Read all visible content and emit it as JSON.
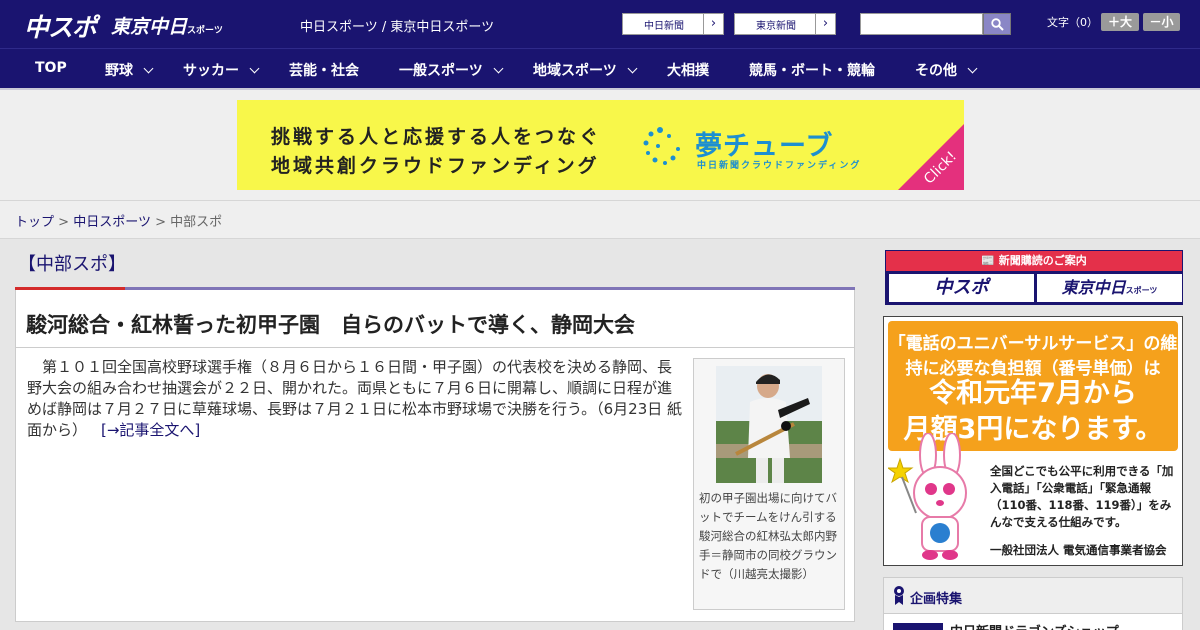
{
  "header": {
    "logo_chuspo": "中スポ",
    "logo_tokyo": "東京中日",
    "logo_tokyo_small": "スポーツ",
    "site_links": "中日スポーツ / 東京中日スポーツ",
    "btn_chunichi": "中日新聞",
    "btn_tokyo": "東京新聞",
    "search_placeholder": "",
    "font_label": "文字（0）",
    "font_bigger": "＋大",
    "font_smaller": "－小"
  },
  "nav": {
    "items": [
      {
        "label": "TOP"
      },
      {
        "label": "野球"
      },
      {
        "label": "サッカー"
      },
      {
        "label": "芸能・社会"
      },
      {
        "label": "一般スポーツ"
      },
      {
        "label": "地域スポーツ"
      },
      {
        "label": "大相撲"
      },
      {
        "label": "競馬・ボート・競輪"
      },
      {
        "label": "その他"
      }
    ]
  },
  "banner": {
    "line1": "挑戦する人と応援する人をつなぐ",
    "line2": "地域共創クラウドファンディング",
    "title": "夢チューブ",
    "subtitle": "中日新聞クラウドファンディング",
    "click": "Click!"
  },
  "breadcrumb": {
    "home": "トップ",
    "section": "中日スポーツ",
    "current": "中部スポ",
    "sep": ">"
  },
  "article": {
    "section_title": "【中部スポ】",
    "headline": "駿河総合・紅林誓った初甲子園　自らのバットで導く、静岡大会",
    "body": "第１０１回全国高校野球選手権（８月６日から１６日間・甲子園）の代表校を決める静岡、長野大会の組み合わせ抽選会が２２日、開かれた。両県ともに７月６日に開幕し、順調に日程が進めば静岡は７月２７日に草薙球場、長野は７月２１日に松本市野球場で決勝を行う。（6月23日 紙面から）",
    "read_more": "[→記事全文へ]",
    "photo_caption": "初の甲子園出場に向けてバットでチームをけん引する駿河総合の紅林弘太郎内野手＝静岡市の同校グラウンドで（川越亮太撮影）"
  },
  "sidebar": {
    "subscribe_head": "新聞購読のご案内",
    "subscribe_chuspo": "中スポ",
    "subscribe_tokyo": "東京中日",
    "subscribe_tokyo_small": "スポーツ",
    "ad_line1": "「電話のユニバーサルサービス」の維持に必要な負担額（番号単価）は",
    "ad_line2": "令和元年7月から",
    "ad_line3": "月額3円になります。",
    "ad_desc": "全国どこでも公平に利用できる「加入電話」「公衆電話」「緊急通報（110番、118番、119番）」をみんなで支える仕組みです。",
    "ad_org": "一般社団法人 電気通信事業者協会",
    "feature_title": "企画特集",
    "feature_item": "中日新聞ドラゴンズショップ"
  },
  "colors": {
    "brand_navy": "#1a1470",
    "accent_red": "#d42b2b",
    "section_purple": "#8075b7",
    "banner_yellow": "#f8f74a",
    "banner_blue": "#1d8fd0",
    "ad_orange": "#f5a11c"
  }
}
